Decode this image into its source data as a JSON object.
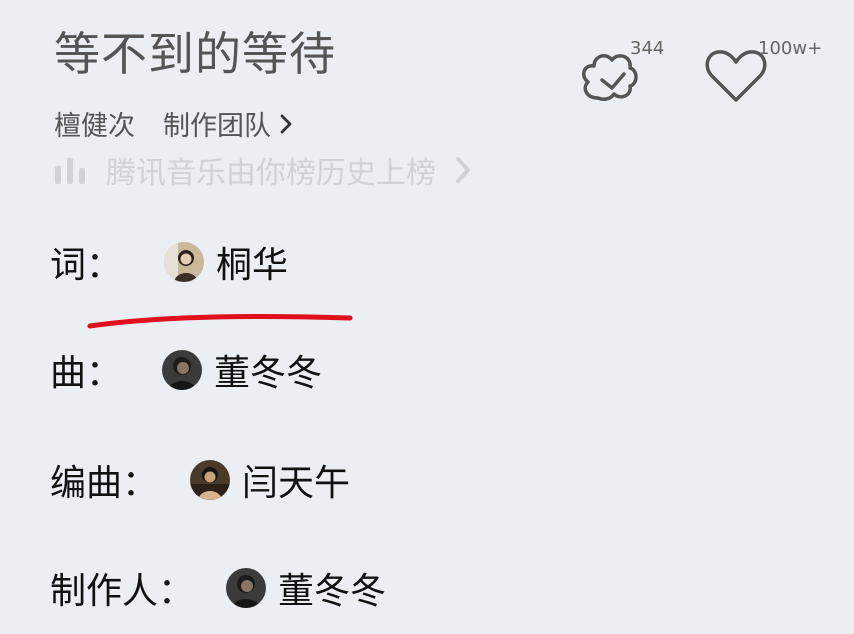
{
  "song": {
    "title": "等不到的等待",
    "singer": "檀健次",
    "team_label": "制作团队"
  },
  "stats": {
    "comments": "344",
    "likes": "100w+"
  },
  "chart_link": "腾讯音乐由你榜历史上榜",
  "credits": [
    {
      "role": "词：",
      "name": "桐华",
      "avatar_icon": "woman-photo-avatar"
    },
    {
      "role": "曲：",
      "name": "董冬冬",
      "avatar_icon": "dark-portrait-avatar"
    },
    {
      "role": "编曲：",
      "name": "闫天午",
      "avatar_icon": "portrait-avatar"
    },
    {
      "role": "制作人：",
      "name": "董冬冬",
      "avatar_icon": "dark-portrait-avatar"
    }
  ],
  "colors": {
    "background": "#ebeef2",
    "annotation": "#e0101e"
  }
}
